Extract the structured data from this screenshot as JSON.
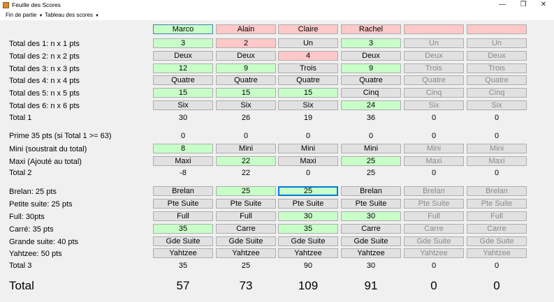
{
  "window": {
    "title": "Feuille des Scores",
    "minimize": "—",
    "maximize": "❐",
    "close": "✕"
  },
  "menu": [
    "Fin de partie",
    "Tableau des scores"
  ],
  "players": [
    {
      "name": "Marco",
      "color": "green"
    },
    {
      "name": "Alain",
      "color": "red"
    },
    {
      "name": "Claire",
      "color": "red"
    },
    {
      "name": "Rachel",
      "color": "red"
    },
    {
      "name": "",
      "color": "red"
    },
    {
      "name": "",
      "color": "red"
    }
  ],
  "labels": {
    "ones": "Total des 1: n x 1 pts",
    "twos": "Total des 2: n x 2 pts",
    "threes": "Total des 3: n x 3 pts",
    "fours": "Total des 4: n x 4 pts",
    "fives": "Total des 5: n x 5 pts",
    "sixes": "Total des 6: n x 6 pts",
    "total1": "Total 1",
    "prime": "Prime 35 pts (si Total 1 >= 63)",
    "mini": "Mini (soustrait du total)",
    "maxi": "Maxi (Ajouté au total)",
    "total2": "Total 2",
    "brelan": "Brelan: 25 pts",
    "petite": "Petite suite: 25 pts",
    "full": "Full: 30pts",
    "carre": "Carré: 35 pts",
    "grande": "Grande suite: 40 pts",
    "yahtzee": "Yahtzee: 50 pts",
    "total3": "Total 3",
    "total": "Total"
  },
  "rows": {
    "ones": [
      {
        "text": "3",
        "color": "green"
      },
      {
        "text": "2",
        "color": "red"
      },
      {
        "text": "Un",
        "color": "gray"
      },
      {
        "text": "3",
        "color": "green"
      },
      {
        "text": "Un",
        "color": "gray",
        "disabled": true
      },
      {
        "text": "Un",
        "color": "gray",
        "disabled": true
      }
    ],
    "twos": [
      {
        "text": "Deux",
        "color": "gray"
      },
      {
        "text": "Deux",
        "color": "gray"
      },
      {
        "text": "4",
        "color": "red"
      },
      {
        "text": "Deux",
        "color": "gray"
      },
      {
        "text": "Deux",
        "color": "gray",
        "disabled": true
      },
      {
        "text": "Deux",
        "color": "gray",
        "disabled": true
      }
    ],
    "threes": [
      {
        "text": "12",
        "color": "green"
      },
      {
        "text": "9",
        "color": "green"
      },
      {
        "text": "Trois",
        "color": "gray"
      },
      {
        "text": "9",
        "color": "green"
      },
      {
        "text": "Trois",
        "color": "gray",
        "disabled": true
      },
      {
        "text": "Trois",
        "color": "gray",
        "disabled": true
      }
    ],
    "fours": [
      {
        "text": "Quatre",
        "color": "gray"
      },
      {
        "text": "Quatre",
        "color": "gray"
      },
      {
        "text": "Quatre",
        "color": "gray"
      },
      {
        "text": "Quatre",
        "color": "gray"
      },
      {
        "text": "Quatre",
        "color": "gray",
        "disabled": true
      },
      {
        "text": "Quatre",
        "color": "gray",
        "disabled": true
      }
    ],
    "fives": [
      {
        "text": "15",
        "color": "green"
      },
      {
        "text": "15",
        "color": "green"
      },
      {
        "text": "15",
        "color": "green"
      },
      {
        "text": "Cinq",
        "color": "gray"
      },
      {
        "text": "Cinq",
        "color": "gray",
        "disabled": true
      },
      {
        "text": "Cinq",
        "color": "gray",
        "disabled": true
      }
    ],
    "sixes": [
      {
        "text": "Six",
        "color": "gray"
      },
      {
        "text": "Six",
        "color": "gray"
      },
      {
        "text": "Six",
        "color": "gray"
      },
      {
        "text": "24",
        "color": "green"
      },
      {
        "text": "Six",
        "color": "gray",
        "disabled": true
      },
      {
        "text": "Six",
        "color": "gray",
        "disabled": true
      }
    ],
    "mini": [
      {
        "text": "8",
        "color": "green"
      },
      {
        "text": "Mini",
        "color": "gray"
      },
      {
        "text": "Mini",
        "color": "gray"
      },
      {
        "text": "Mini",
        "color": "gray"
      },
      {
        "text": "Mini",
        "color": "gray",
        "disabled": true
      },
      {
        "text": "Mini",
        "color": "gray",
        "disabled": true
      }
    ],
    "maxi": [
      {
        "text": "Maxi",
        "color": "gray"
      },
      {
        "text": "22",
        "color": "green"
      },
      {
        "text": "Maxi",
        "color": "gray"
      },
      {
        "text": "25",
        "color": "green"
      },
      {
        "text": "Maxi",
        "color": "gray",
        "disabled": true
      },
      {
        "text": "Maxi",
        "color": "gray",
        "disabled": true
      }
    ],
    "brelan": [
      {
        "text": "Brelan",
        "color": "gray"
      },
      {
        "text": "25",
        "color": "green"
      },
      {
        "text": "25",
        "color": "green",
        "focused": true
      },
      {
        "text": "Brelan",
        "color": "gray"
      },
      {
        "text": "Brelan",
        "color": "gray",
        "disabled": true
      },
      {
        "text": "Brelan",
        "color": "gray",
        "disabled": true
      }
    ],
    "petite": [
      {
        "text": "Pte Suite",
        "color": "gray"
      },
      {
        "text": "Pte Suite",
        "color": "gray"
      },
      {
        "text": "Pte Suite",
        "color": "gray"
      },
      {
        "text": "Pte Suite",
        "color": "gray"
      },
      {
        "text": "Pte Suite",
        "color": "gray",
        "disabled": true
      },
      {
        "text": "Pte Suite",
        "color": "gray",
        "disabled": true
      }
    ],
    "full": [
      {
        "text": "Full",
        "color": "gray"
      },
      {
        "text": "Full",
        "color": "gray"
      },
      {
        "text": "30",
        "color": "green"
      },
      {
        "text": "30",
        "color": "green"
      },
      {
        "text": "Full",
        "color": "gray",
        "disabled": true
      },
      {
        "text": "Full",
        "color": "gray",
        "disabled": true
      }
    ],
    "carre": [
      {
        "text": "35",
        "color": "green"
      },
      {
        "text": "Carre",
        "color": "gray"
      },
      {
        "text": "35",
        "color": "green"
      },
      {
        "text": "Carre",
        "color": "gray"
      },
      {
        "text": "Carre",
        "color": "gray",
        "disabled": true
      },
      {
        "text": "Carre",
        "color": "gray",
        "disabled": true
      }
    ],
    "grande": [
      {
        "text": "Gde Suite",
        "color": "gray"
      },
      {
        "text": "Gde Suite",
        "color": "gray"
      },
      {
        "text": "Gde Suite",
        "color": "gray"
      },
      {
        "text": "Gde Suite",
        "color": "gray"
      },
      {
        "text": "Gde Suite",
        "color": "gray",
        "disabled": true
      },
      {
        "text": "Gde Suite",
        "color": "gray",
        "disabled": true
      }
    ],
    "yahtzee": [
      {
        "text": "Yahtzee",
        "color": "gray"
      },
      {
        "text": "Yahtzee",
        "color": "gray"
      },
      {
        "text": "Yahtzee",
        "color": "gray"
      },
      {
        "text": "Yahtzee",
        "color": "gray"
      },
      {
        "text": "Yahtzee",
        "color": "gray",
        "disabled": true
      },
      {
        "text": "Yahtzee",
        "color": "gray",
        "disabled": true
      }
    ]
  },
  "totals": {
    "total1": [
      "30",
      "26",
      "19",
      "36",
      "0",
      "0"
    ],
    "prime": [
      "0",
      "0",
      "0",
      "0",
      "0",
      "0"
    ],
    "total2": [
      "-8",
      "22",
      "0",
      "25",
      "0",
      "0"
    ],
    "total3": [
      "35",
      "25",
      "90",
      "30",
      "0",
      "0"
    ],
    "total": [
      "57",
      "73",
      "109",
      "91",
      "0",
      "0"
    ]
  },
  "colors": {
    "green": "#c8ffc8",
    "red": "#ffc8c8",
    "gray": "#e1e1e1"
  }
}
